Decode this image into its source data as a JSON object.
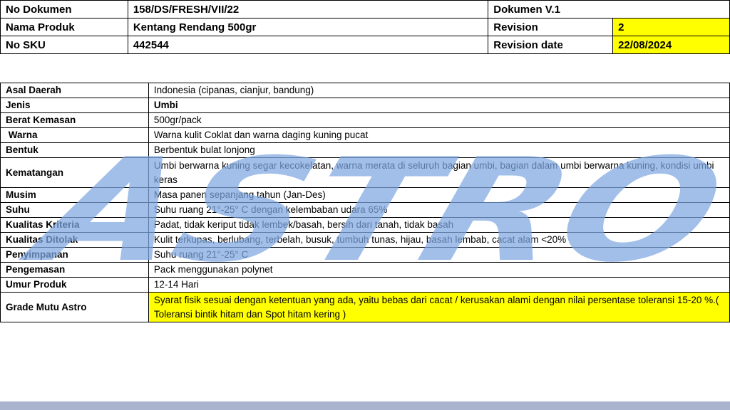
{
  "header": {
    "doc_no_label": "No Dokumen",
    "doc_no_value": "158/DS/FRESH/VII/22",
    "doc_version": "Dokumen V.1",
    "product_label": "Nama Produk",
    "product_value": "Kentang Rendang 500gr",
    "revision_label": "Revision",
    "revision_value": "2",
    "sku_label": "No SKU",
    "sku_value": "442544",
    "revision_date_label": "Revision date",
    "revision_date_value": "22/08/2024",
    "highlight_color": "#ffff00"
  },
  "spec": [
    {
      "label": "Asal Daerah",
      "value": "Indonesia (cipanas, cianjur, bandung)"
    },
    {
      "label": "Jenis",
      "value": "Umbi"
    },
    {
      "label": "Berat Kemasan",
      "value": "500gr/pack"
    },
    {
      "label": " Warna",
      "value": "Warna kulit Coklat dan warna daging kuning pucat"
    },
    {
      "label": "Bentuk",
      "value": "Berbentuk bulat lonjong"
    },
    {
      "label": "Kematangan",
      "value": "Umbi berwarna kuning segar kecokelatan, warna merata di seluruh bagian umbi, bagian dalam umbi berwarna kuning, kondisi umbi keras"
    },
    {
      "label": "Musim",
      "value": "Masa panen sepanjang tahun (Jan-Des)"
    },
    {
      "label": "Suhu",
      "value": "Suhu ruang 21°-25° C dengan kelembaban udara 65%"
    },
    {
      "label": "Kualitas Kriteria",
      "value": "Padat, tidak keriput tidak lembek/basah, bersih dari tanah, tidak basah"
    },
    {
      "label": "Kualitas Ditolak",
      "value": "Kulit terkupas, berlubang, terbelah, busuk, tumbuh tunas, hijau, basah lembab, cacat alam <20%"
    },
    {
      "label": "Penyimpanan",
      "value": "Suhu ruang 21°-25° C"
    },
    {
      "label": "Pengemasan",
      "value": "Pack menggunakan polynet"
    },
    {
      "label": "Umur Produk",
      "value": "12-14 Hari"
    },
    {
      "label": "Grade Mutu Astro",
      "value": "Syarat fisik sesuai dengan ketentuan yang ada, yaitu bebas dari cacat / kerusakan alami dengan nilai persentase toleransi 15-20 %.( Toleransi bintik hitam dan Spot hitam kering )"
    }
  ],
  "watermark": {
    "text": "ASTRO",
    "color": "#7ea6e0"
  },
  "colors": {
    "bottom_bar": "#aab4ce"
  }
}
